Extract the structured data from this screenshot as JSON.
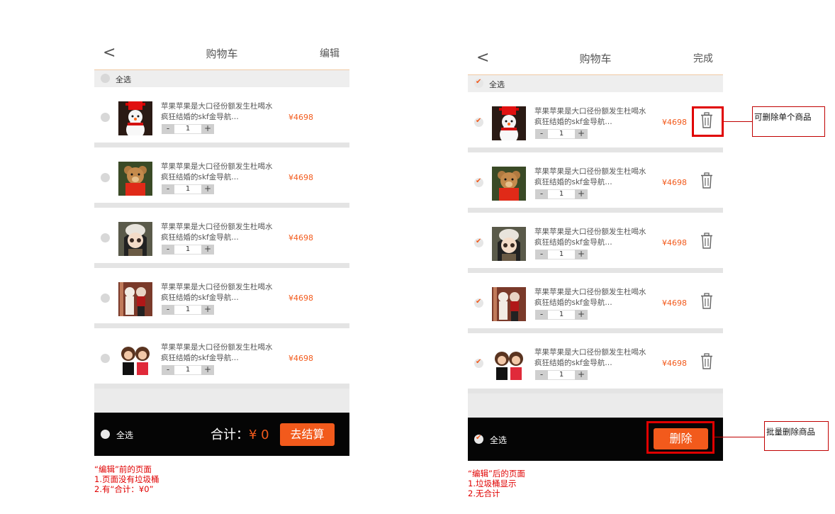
{
  "left": {
    "nav": {
      "back": "<",
      "title": "购物车",
      "action": "编辑"
    },
    "select_all": "全选",
    "items": [
      {
        "desc": "苹果苹果是大口径份额发生杜喝水疯狂结婚的skf金导航…",
        "qty": "1",
        "price": "¥4698",
        "minus": "-",
        "plus": "+"
      },
      {
        "desc": "苹果苹果是大口径份额发生杜喝水疯狂结婚的skf金导航…",
        "qty": "1",
        "price": "¥4698",
        "minus": "-",
        "plus": "+"
      },
      {
        "desc": "苹果苹果是大口径份额发生杜喝水疯狂结婚的skf金导航…",
        "qty": "1",
        "price": "¥4698",
        "minus": "-",
        "plus": "+"
      },
      {
        "desc": "苹果苹果是大口径份额发生杜喝水疯狂结婚的skf金导航…",
        "qty": "1",
        "price": "¥4698",
        "minus": "-",
        "plus": "+"
      },
      {
        "desc": "苹果苹果是大口径份额发生杜喝水疯狂结婚的skf金导航…",
        "qty": "1",
        "price": "¥4698",
        "minus": "-",
        "plus": "+"
      }
    ],
    "footer": {
      "select_all": "全选",
      "total_label": "合计：",
      "total_value": "¥ 0",
      "checkout": "去结算"
    }
  },
  "right": {
    "nav": {
      "back": "<",
      "title": "购物车",
      "action": "完成"
    },
    "select_all": "全选",
    "items": [
      {
        "desc": "苹果苹果是大口径份额发生杜喝水疯狂结婚的skf金导航…",
        "qty": "1",
        "price": "¥4698",
        "minus": "-",
        "plus": "+"
      },
      {
        "desc": "苹果苹果是大口径份额发生杜喝水疯狂结婚的skf金导航…",
        "qty": "1",
        "price": "¥4698",
        "minus": "-",
        "plus": "+"
      },
      {
        "desc": "苹果苹果是大口径份额发生杜喝水疯狂结婚的skf金导航…",
        "qty": "1",
        "price": "¥4698",
        "minus": "-",
        "plus": "+"
      },
      {
        "desc": "苹果苹果是大口径份额发生杜喝水疯狂结婚的skf金导航…",
        "qty": "1",
        "price": "¥4698",
        "minus": "-",
        "plus": "+"
      },
      {
        "desc": "苹果苹果是大口径份额发生杜喝水疯狂结婚的skf金导航…",
        "qty": "1",
        "price": "¥4698",
        "minus": "-",
        "plus": "+"
      }
    ],
    "footer": {
      "select_all": "全选",
      "delete": "删除"
    }
  },
  "annotations": {
    "single_delete": "可删除单个商品",
    "batch_delete": "批量删除商品",
    "left_notes": [
      "“编辑”前的页面",
      "1.页面没有垃圾桶",
      "2.有“合计：¥0”"
    ],
    "right_notes": [
      "“编辑”后的页面",
      "1.垃圾桶显示",
      "2.无合计"
    ]
  },
  "colors": {
    "accent": "#f25a1c",
    "annotation": "#e00000",
    "footer_bg": "#050505"
  },
  "icons": {
    "back": "chevron-left-icon",
    "trash": "trash-icon",
    "check": "check-icon"
  }
}
